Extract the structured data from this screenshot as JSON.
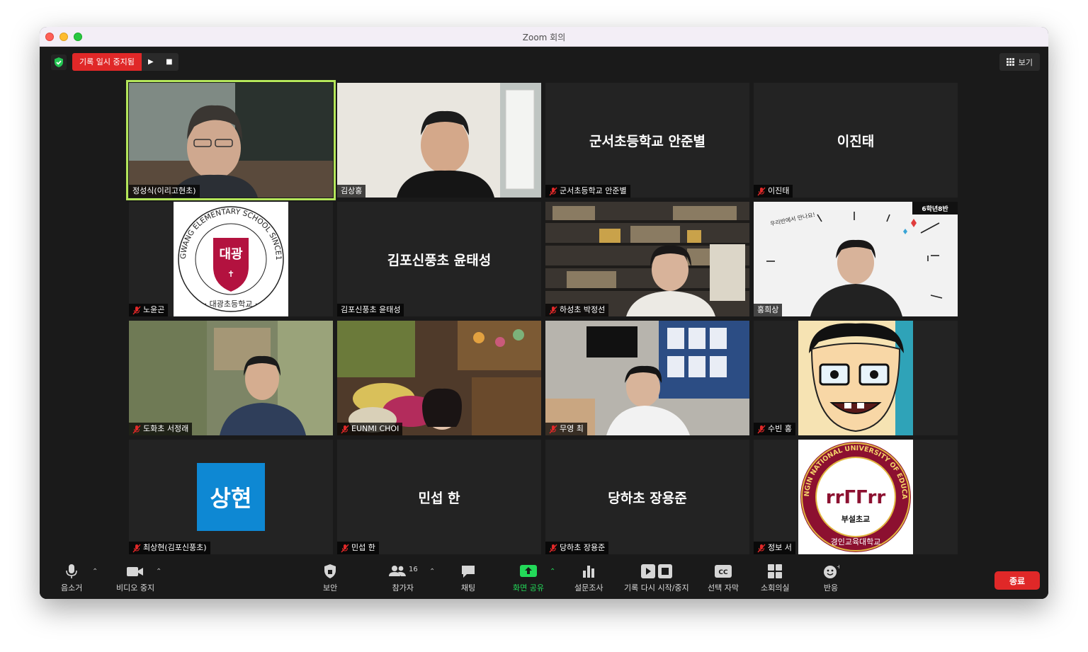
{
  "window": {
    "title": "Zoom 회의"
  },
  "recording": {
    "status": "기록 일시 중지됨"
  },
  "view": {
    "label": "보기"
  },
  "participants": [
    {
      "name": "정성식(이리고현초)",
      "video": true,
      "muted": false,
      "active_speaker": true
    },
    {
      "name": "김상홍",
      "video": true,
      "muted": false
    },
    {
      "name": "군서초등학교 안준별",
      "video": false,
      "muted": true,
      "display": "군서초등학교 안준별"
    },
    {
      "name": "이진태",
      "video": false,
      "muted": true,
      "display": "이진태"
    },
    {
      "name": "노윤곤",
      "video": true,
      "muted": true,
      "logo": {
        "top": "DAEGWANG ELEMENTARY SCHOOL SINCE1965",
        "shield": "대광",
        "bottom": "· 대광초등학교 ·"
      }
    },
    {
      "name": "김포신풍초 윤태성",
      "video": false,
      "muted": false,
      "display": "김포신풍초 윤태성"
    },
    {
      "name": "하성초 박정선",
      "video": true,
      "muted": true
    },
    {
      "name": "홍희상",
      "video": true,
      "muted": false,
      "corner_label": "6학년8반",
      "doodle_text": "우리반에서 만나요!"
    },
    {
      "name": "도화초 서정래",
      "video": true,
      "muted": true
    },
    {
      "name": "EUNMI CHOI",
      "video": true,
      "muted": true
    },
    {
      "name": "무영 최",
      "video": true,
      "muted": true
    },
    {
      "name": "수빈 홍",
      "video": true,
      "muted": true
    },
    {
      "name": "최상현(김포신풍초)",
      "video": false,
      "muted": true,
      "avatar": "상현"
    },
    {
      "name": "민섭 한",
      "video": false,
      "muted": true,
      "display": "민섭 한"
    },
    {
      "name": "당하초 장용준",
      "video": false,
      "muted": true,
      "display": "당하초 장용준"
    },
    {
      "name": "정보 서",
      "video": true,
      "muted": true,
      "logo": {
        "ring": "GYEONGIN NATIONAL UNIVERSITY OF EDUCATION",
        "mark": "rrΓΓrr",
        "center": "부설초교",
        "bottom": "경인교육대학교"
      }
    }
  ],
  "toolbar": {
    "mute": "음소거",
    "video": "비디오 중지",
    "security": "보안",
    "participants": "참가자",
    "participant_count": "16",
    "chat": "채팅",
    "share": "화면 공유",
    "polls": "설문조사",
    "record": "기록 다시 시작/중지",
    "captions": "선택 자막",
    "breakout": "소회의실",
    "reactions": "반응",
    "end": "종료"
  },
  "colors": {
    "end": "#e02828",
    "share": "#23d959",
    "active_speaker": "#b4e65a",
    "avatar": "#0e88d3"
  }
}
